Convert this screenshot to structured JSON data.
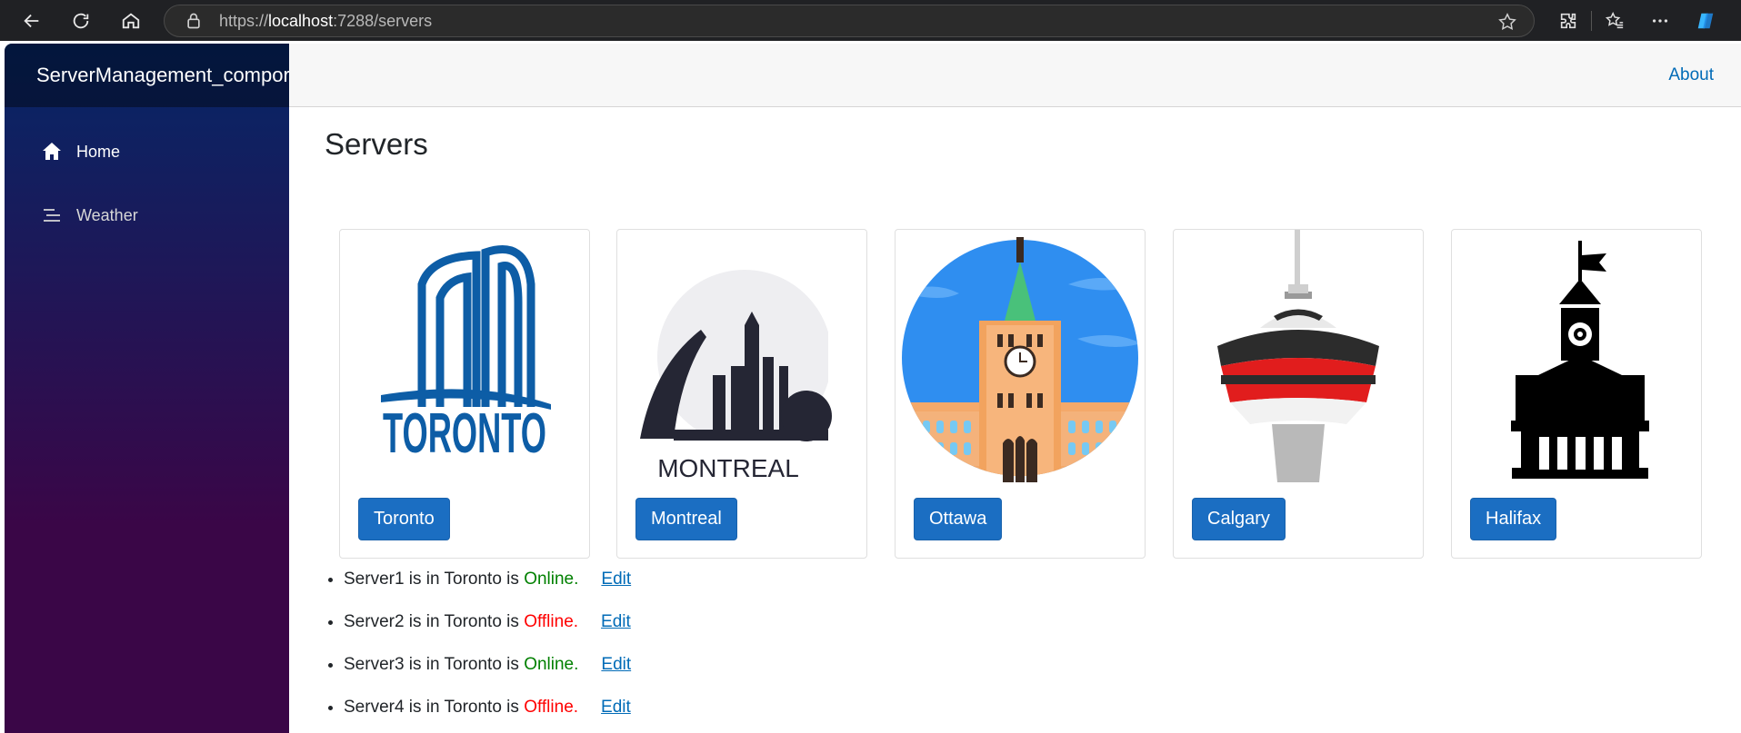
{
  "browser": {
    "url_scheme": "https://",
    "url_host": "localhost",
    "url_path": ":7288/servers"
  },
  "sidebar": {
    "brand": "ServerManagement_compor",
    "items": [
      {
        "label": "Home",
        "icon": "home-icon"
      },
      {
        "label": "Weather",
        "icon": "list-icon"
      }
    ]
  },
  "top_row": {
    "about_label": "About"
  },
  "page": {
    "title": "Servers"
  },
  "cities": [
    {
      "name": "Toronto",
      "image": "toronto-logo-image"
    },
    {
      "name": "Montreal",
      "image": "montreal-skyline-image",
      "image_text": "MONTREAL"
    },
    {
      "name": "Ottawa",
      "image": "ottawa-parliament-image"
    },
    {
      "name": "Calgary",
      "image": "calgary-tower-image"
    },
    {
      "name": "Halifax",
      "image": "halifax-town-clock-image"
    }
  ],
  "servers": [
    {
      "prefix": "Server1 is in Toronto is ",
      "status": "Online.",
      "edit": "Edit"
    },
    {
      "prefix": "Server2 is in Toronto is ",
      "status": "Offline.",
      "edit": "Edit"
    },
    {
      "prefix": "Server3 is in Toronto is ",
      "status": "Online.",
      "edit": "Edit"
    },
    {
      "prefix": "Server4 is in Toronto is ",
      "status": "Offline.",
      "edit": "Edit"
    }
  ],
  "colors": {
    "online": "#008000",
    "offline": "#ff0000",
    "button": "#1b6ec2",
    "link": "#006bb7"
  }
}
